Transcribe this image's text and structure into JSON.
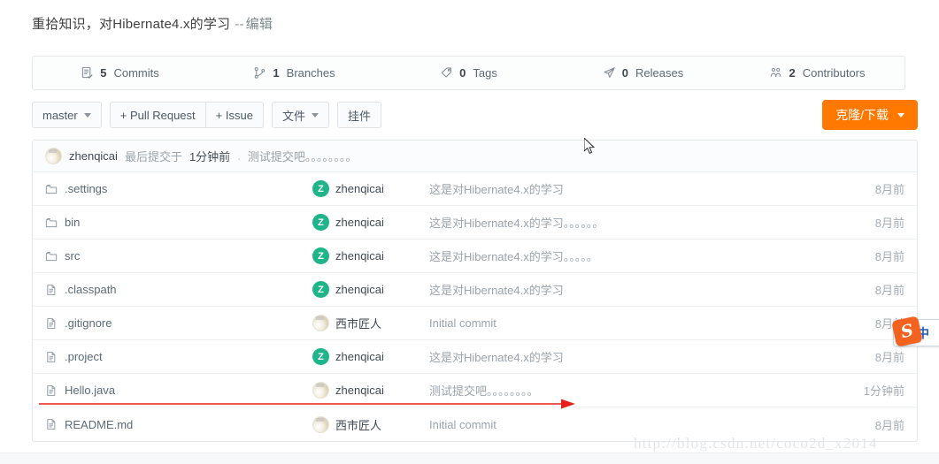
{
  "repo": {
    "title": "重拾知识，对Hibernate4.x的学习",
    "title_separator": "--",
    "edit_link": "编辑"
  },
  "stats": [
    {
      "icon": "commits-icon",
      "count": "5",
      "label": "Commits"
    },
    {
      "icon": "branches-icon",
      "count": "1",
      "label": "Branches"
    },
    {
      "icon": "tags-icon",
      "count": "0",
      "label": "Tags"
    },
    {
      "icon": "releases-icon",
      "count": "0",
      "label": "Releases"
    },
    {
      "icon": "contributors-icon",
      "count": "2",
      "label": "Contributors"
    }
  ],
  "toolbar": {
    "branch_button": "master",
    "pull_request_button": "+ Pull Request",
    "issue_button": "+ Issue",
    "files_button": "文件",
    "widget_button": "挂件",
    "clone_button": "克隆/下载"
  },
  "latest_commit": {
    "avatar": "photo",
    "author": "zhenqicai",
    "prefix": "最后提交于",
    "time": "1分钟前",
    "separator": ".",
    "message": "测试提交吧。。。。。。。。"
  },
  "files": [
    {
      "icon": "folder-icon",
      "name": ".settings",
      "avatar": "letter",
      "avatar_letter": "Z",
      "author": "zhenqicai",
      "message": "这是对Hibernate4.x的学习",
      "time": "8月前"
    },
    {
      "icon": "folder-icon",
      "name": "bin",
      "avatar": "letter",
      "avatar_letter": "Z",
      "author": "zhenqicai",
      "message": "这是对Hibernate4.x的学习。。。。。。",
      "time": "8月前"
    },
    {
      "icon": "folder-icon",
      "name": "src",
      "avatar": "letter",
      "avatar_letter": "Z",
      "author": "zhenqicai",
      "message": "这是对Hibernate4.x的学习。。。。。",
      "time": "8月前"
    },
    {
      "icon": "file-icon",
      "name": ".classpath",
      "avatar": "letter",
      "avatar_letter": "Z",
      "author": "zhenqicai",
      "message": "这是对Hibernate4.x的学习",
      "time": "8月前"
    },
    {
      "icon": "file-icon",
      "name": ".gitignore",
      "avatar": "photo",
      "avatar_letter": "",
      "author": "西市匠人",
      "message": "Initial commit",
      "time": "8月前"
    },
    {
      "icon": "file-icon",
      "name": ".project",
      "avatar": "letter",
      "avatar_letter": "Z",
      "author": "zhenqicai",
      "message": "这是对Hibernate4.x的学习",
      "time": "8月前"
    },
    {
      "icon": "file-icon",
      "name": "Hello.java",
      "avatar": "photo",
      "avatar_letter": "",
      "author": "zhenqicai",
      "message": "测试提交吧。。。。。。。。",
      "time": "1分钟前"
    },
    {
      "icon": "file-icon",
      "name": "README.md",
      "avatar": "photo",
      "avatar_letter": "",
      "author": "西市匠人",
      "message": "Initial commit",
      "time": "8月前"
    }
  ],
  "ime": {
    "logo_letter": "S",
    "mode_label": "中"
  },
  "watermark": "http://blog.csdn.net/coco2d_x2014",
  "colors": {
    "accent_orange": "#ff7800",
    "avatar_green": "#20b48a",
    "annotation_red": "#e8201a",
    "border": "#e4e8eb"
  }
}
